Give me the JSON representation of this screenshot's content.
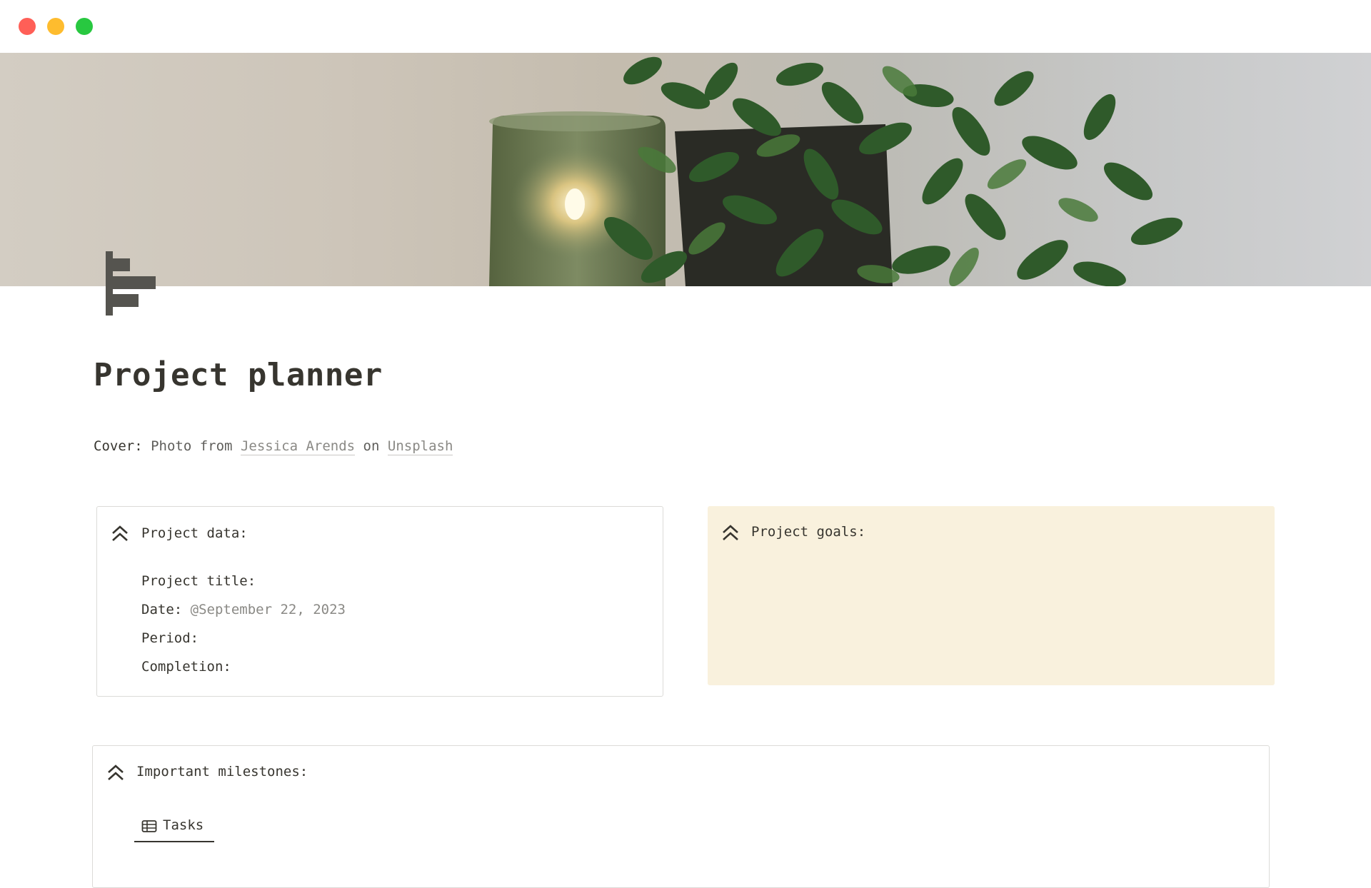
{
  "window": {
    "traffic_lights": [
      {
        "name": "close",
        "color": "#ff5f57"
      },
      {
        "name": "minimize",
        "color": "#febc2e"
      },
      {
        "name": "zoom",
        "color": "#28c840"
      }
    ]
  },
  "page": {
    "icon": "gantt-chart-icon",
    "title": "Project planner",
    "cover_credit": {
      "label": "Cover:",
      "text_before": "Photo from",
      "author_link": "Jessica Arends",
      "text_between": "on",
      "source_link": "Unsplash"
    }
  },
  "callouts": {
    "project_data": {
      "icon": "double-chevron-up-icon",
      "heading": "Project data:",
      "fields": [
        {
          "label": "Project title:",
          "value": ""
        },
        {
          "label": "Date:",
          "value": "@September 22, 2023"
        },
        {
          "label": "Period:",
          "value": ""
        },
        {
          "label": "Completion:",
          "value": ""
        }
      ]
    },
    "project_goals": {
      "icon": "double-chevron-up-icon",
      "heading": "Project goals:",
      "background": "#f9f1dd"
    },
    "milestones": {
      "icon": "double-chevron-up-icon",
      "heading": "Important milestones:",
      "tabs": [
        {
          "icon": "table-icon",
          "label": "Tasks",
          "active": true
        }
      ]
    }
  }
}
